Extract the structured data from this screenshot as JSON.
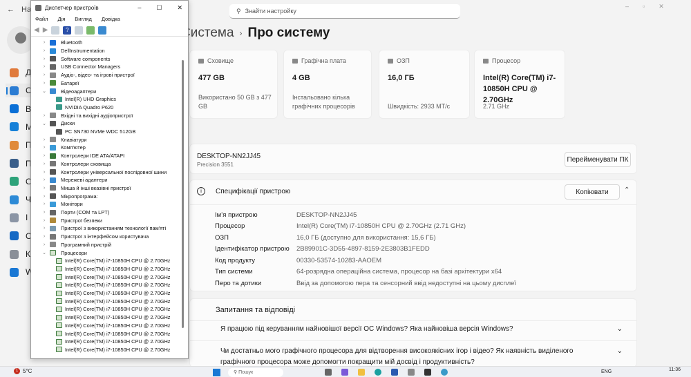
{
  "settings": {
    "back_label": "На",
    "search_placeholder": "Знайти настройку",
    "breadcrumb_parent": "Система",
    "breadcrumb_sep": "›",
    "page_title": "Про систему",
    "sidebar": [
      {
        "label": "Д",
        "icon": "home-icon",
        "color": "#e07a3c"
      },
      {
        "label": "С",
        "icon": "system-icon",
        "color": "#2b7cd3",
        "active": true
      },
      {
        "label": "B",
        "icon": "bluetooth-icon",
        "color": "#0a6fd6"
      },
      {
        "label": "М",
        "icon": "network-icon",
        "color": "#1680d8"
      },
      {
        "label": "П",
        "icon": "personalization-icon",
        "color": "#e08a3a"
      },
      {
        "label": "П",
        "icon": "apps-icon",
        "color": "#3a5f8a"
      },
      {
        "label": "О",
        "icon": "accounts-icon",
        "color": "#2ea37a"
      },
      {
        "label": "Ч",
        "icon": "time-language-icon",
        "color": "#2d8ad6"
      },
      {
        "label": "І",
        "icon": "gaming-icon",
        "color": "#8b95a5"
      },
      {
        "label": "С",
        "icon": "accessibility-icon",
        "color": "#1669c4"
      },
      {
        "label": "К",
        "icon": "privacy-shield-icon",
        "color": "#8a8f98"
      },
      {
        "label": "W",
        "icon": "windows-update-icon",
        "color": "#1a78d4"
      }
    ],
    "cards": [
      {
        "caption": "Сховище",
        "value": "477 GB",
        "footer": "Використано 50 GB з 477 GB"
      },
      {
        "caption": "Графічна плата",
        "value": "4 GB",
        "footer": "Інстальовано кілька графічних процесорів"
      },
      {
        "caption": "ОЗП",
        "value": "16,0 ГБ",
        "footer": "Швидкість: 2933 MT/c"
      },
      {
        "caption": "Процесор",
        "value": "Intel(R) Core(TM) i7-10850H CPU @ 2.70GHz",
        "footer": "2.71 GHz"
      }
    ],
    "device": {
      "name": "DESKTOP-NN2JJ45",
      "model": "Precision 3551",
      "rename_button": "Перейменувати ПК"
    },
    "specs": {
      "title": "Специфікації пристрою",
      "copy_button": "Копіювати",
      "rows": [
        {
          "k": "Ім’я пристрою",
          "v": "DESKTOP-NN2JJ45"
        },
        {
          "k": "Процесор",
          "v": "Intel(R) Core(TM) i7-10850H CPU @ 2.70GHz (2.71 GHz)"
        },
        {
          "k": "ОЗП",
          "v": "16,0 ГБ (доступно для використання: 15,6 ГБ)"
        },
        {
          "k": "Ідентифікатор пристрою",
          "v": "2B89901C-3D55-4897-8159-2E3803B1FEDD"
        },
        {
          "k": "Код продукту",
          "v": "00330-53574-10283-AAOEM"
        },
        {
          "k": "Тип системи",
          "v": "64-розрядна операційна система, процесор на базі архітектури x64"
        },
        {
          "k": "Перо та дотики",
          "v": "Ввід за допомогою пера та сенсорний ввід недоступні на цьому дисплеї"
        }
      ]
    },
    "faq": {
      "title": "Запитання та відповіді",
      "items": [
        "Я працюю під керуванням найновішої версії ОС Windows? Яка найновіша версія Windows?",
        "Чи достатньо мого графічного процесора для відтворення високоякісних ігор і відео? Як наявність виділеного графічного процесора може допомогти покращити мій досвід і продуктивність?"
      ]
    }
  },
  "device_manager": {
    "title": "Диспетчер пристроїв",
    "menu": [
      "Файл",
      "Дія",
      "Вигляд",
      "Довідка"
    ],
    "tree": [
      {
        "label": "Bluetooth",
        "level": 0,
        "state": "collapsed",
        "color": "#1a6fd6"
      },
      {
        "label": "DellInstrumentation",
        "level": 0,
        "state": "collapsed",
        "color": "#2b8ad8"
      },
      {
        "label": "Software components",
        "level": 0,
        "state": "collapsed",
        "color": "#555"
      },
      {
        "label": "USB Connector Managers",
        "level": 0,
        "state": "collapsed",
        "color": "#666"
      },
      {
        "label": "Аудіо-, відео- та ігрові пристрої",
        "level": 0,
        "state": "collapsed",
        "color": "#888"
      },
      {
        "label": "Батареї",
        "level": 0,
        "state": "collapsed",
        "color": "#4a8a3a"
      },
      {
        "label": "Відеоадаптери",
        "level": 0,
        "state": "expanded",
        "color": "#3a8ad0"
      },
      {
        "label": "Intel(R) UHD Graphics",
        "level": 1,
        "state": "leaf",
        "color": "#3a9a8a"
      },
      {
        "label": "NVIDIA Quadro P620",
        "level": 1,
        "state": "leaf",
        "color": "#3a9a8a"
      },
      {
        "label": "Вхідні та вихідні аудіопристрої",
        "level": 0,
        "state": "collapsed",
        "color": "#888"
      },
      {
        "label": "Диски",
        "level": 0,
        "state": "expanded",
        "color": "#555"
      },
      {
        "label": "PC SN730 NVMe WDC 512GB",
        "level": 1,
        "state": "leaf",
        "color": "#555"
      },
      {
        "label": "Клавіатури",
        "level": 0,
        "state": "collapsed",
        "color": "#888"
      },
      {
        "label": "Комп'ютер",
        "level": 0,
        "state": "collapsed",
        "color": "#3a9ad8"
      },
      {
        "label": "Контролери IDE ATA/ATAPI",
        "level": 0,
        "state": "collapsed",
        "color": "#3a7a3a"
      },
      {
        "label": "Контролери сховища",
        "level": 0,
        "state": "collapsed",
        "color": "#777"
      },
      {
        "label": "Контролери універсальної послідовної шини",
        "level": 0,
        "state": "collapsed",
        "color": "#555"
      },
      {
        "label": "Мережеві адаптери",
        "level": 0,
        "state": "collapsed",
        "color": "#3a8ad0"
      },
      {
        "label": "Миша й інші вказівні пристрої",
        "level": 0,
        "state": "collapsed",
        "color": "#777"
      },
      {
        "label": "Мікропрограма:",
        "level": 0,
        "state": "collapsed",
        "color": "#555"
      },
      {
        "label": "Монітори",
        "level": 0,
        "state": "collapsed",
        "color": "#3a9ad8"
      },
      {
        "label": "Порти (COM та LPT)",
        "level": 0,
        "state": "collapsed",
        "color": "#666"
      },
      {
        "label": "Пристрої безпеки",
        "level": 0,
        "state": "collapsed",
        "color": "#b08a3a"
      },
      {
        "label": "Пристрої з використанням технології пам'яті",
        "level": 0,
        "state": "collapsed",
        "color": "#7a9ab0"
      },
      {
        "label": "Пристрої з інтерфейсом користувача",
        "level": 0,
        "state": "collapsed",
        "color": "#777"
      },
      {
        "label": "Програмний пристрій",
        "level": 0,
        "state": "collapsed",
        "color": "#888"
      },
      {
        "label": "Процесори",
        "level": 0,
        "state": "expanded",
        "color": "cpu"
      },
      {
        "label": "Intel(R) Core(TM) i7-10850H CPU @ 2.70GHz",
        "level": 1,
        "state": "leaf",
        "color": "cpu"
      },
      {
        "label": "Intel(R) Core(TM) i7-10850H CPU @ 2.70GHz",
        "level": 1,
        "state": "leaf",
        "color": "cpu"
      },
      {
        "label": "Intel(R) Core(TM) i7-10850H CPU @ 2.70GHz",
        "level": 1,
        "state": "leaf",
        "color": "cpu"
      },
      {
        "label": "Intel(R) Core(TM) i7-10850H CPU @ 2.70GHz",
        "level": 1,
        "state": "leaf",
        "color": "cpu"
      },
      {
        "label": "Intel(R) Core(TM) i7-10850H CPU @ 2.70GHz",
        "level": 1,
        "state": "leaf",
        "color": "cpu"
      },
      {
        "label": "Intel(R) Core(TM) i7-10850H CPU @ 2.70GHz",
        "level": 1,
        "state": "leaf",
        "color": "cpu"
      },
      {
        "label": "Intel(R) Core(TM) i7-10850H CPU @ 2.70GHz",
        "level": 1,
        "state": "leaf",
        "color": "cpu"
      },
      {
        "label": "Intel(R) Core(TM) i7-10850H CPU @ 2.70GHz",
        "level": 1,
        "state": "leaf",
        "color": "cpu"
      },
      {
        "label": "Intel(R) Core(TM) i7-10850H CPU @ 2.70GHz",
        "level": 1,
        "state": "leaf",
        "color": "cpu"
      },
      {
        "label": "Intel(R) Core(TM) i7-10850H CPU @ 2.70GHz",
        "level": 1,
        "state": "leaf",
        "color": "cpu"
      },
      {
        "label": "Intel(R) Core(TM) i7-10850H CPU @ 2.70GHz",
        "level": 1,
        "state": "leaf",
        "color": "cpu"
      },
      {
        "label": "Intel(R) Core(TM) i7-10850H CPU @ 2.70GHz",
        "level": 1,
        "state": "leaf",
        "color": "cpu"
      }
    ]
  },
  "taskbar": {
    "weather": "5°C",
    "weather_badge": "1",
    "search_placeholder": "Пошук",
    "lang": "ENG",
    "time": "11:36"
  }
}
